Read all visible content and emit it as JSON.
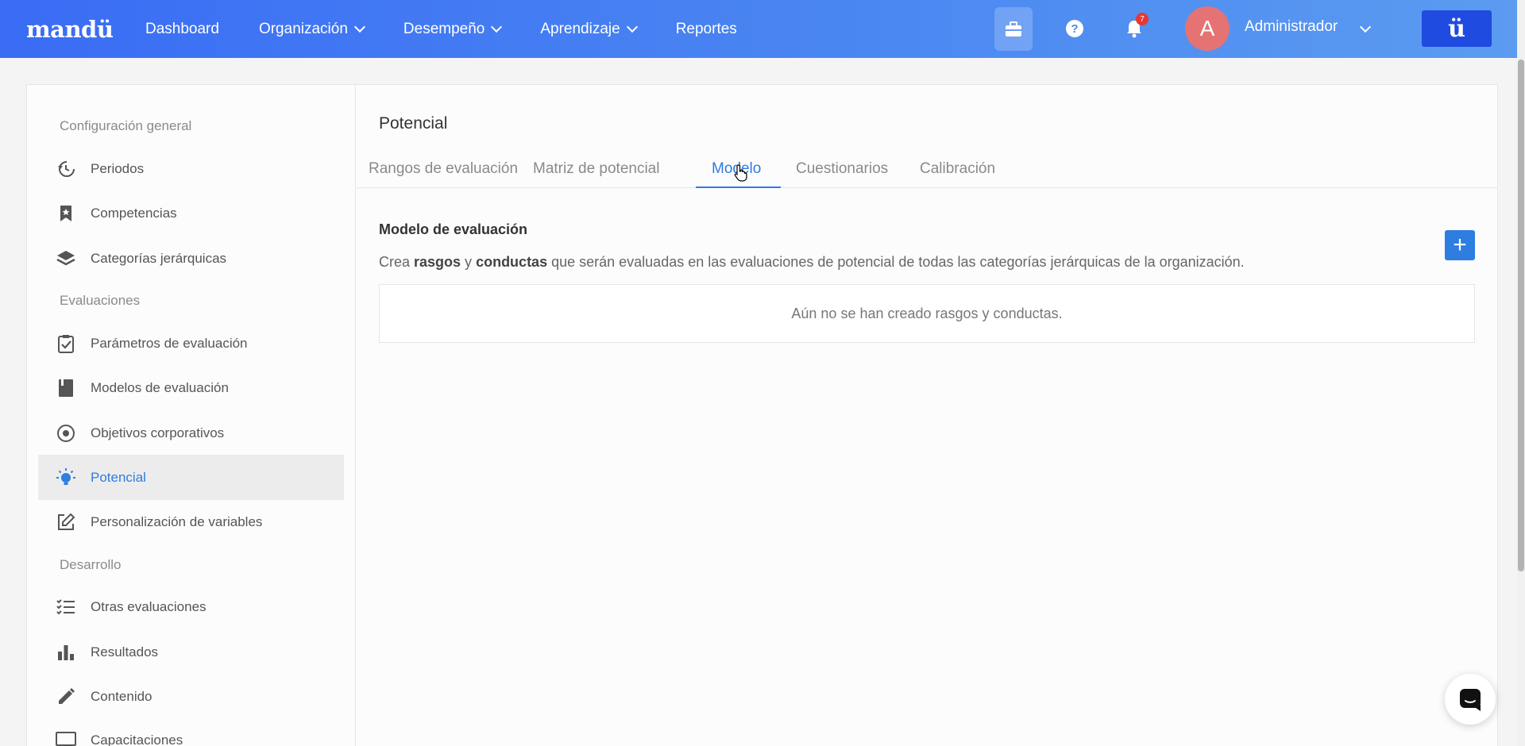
{
  "topnav": {
    "logo": "mandü",
    "items": [
      {
        "label": "Dashboard"
      },
      {
        "label": "Organización"
      },
      {
        "label": "Desempeño"
      },
      {
        "label": "Aprendizaje"
      },
      {
        "label": "Reportes"
      }
    ],
    "notifications_count": "7",
    "avatar_letter": "A",
    "user_name": "Administrador",
    "brand_button": "ü"
  },
  "sidebar": {
    "sections": [
      {
        "title": "Configuración general"
      },
      {
        "title": "Evaluaciones"
      },
      {
        "title": "Desarrollo"
      }
    ],
    "items": [
      {
        "label": "Periodos",
        "icon": "history-icon"
      },
      {
        "label": "Competencias",
        "icon": "bookmark-icon"
      },
      {
        "label": "Categorías jerárquicas",
        "icon": "layers-icon"
      },
      {
        "label": "Parámetros de evaluación",
        "icon": "clipboard-check-icon"
      },
      {
        "label": "Modelos de evaluación",
        "icon": "book-icon"
      },
      {
        "label": "Objetivos corporativos",
        "icon": "target-icon"
      },
      {
        "label": "Potencial",
        "icon": "lightbulb-icon",
        "active": true
      },
      {
        "label": "Personalización de variables",
        "icon": "edit-icon"
      },
      {
        "label": "Otras evaluaciones",
        "icon": "checklist-icon"
      },
      {
        "label": "Resultados",
        "icon": "bar-chart-icon"
      },
      {
        "label": "Contenido",
        "icon": "pencil-icon"
      },
      {
        "label": "Capacitaciones",
        "icon": "monitor-icon"
      }
    ]
  },
  "main": {
    "title": "Potencial",
    "tabs": [
      {
        "label": "Rangos de evaluación"
      },
      {
        "label": "Matriz de potencial"
      },
      {
        "label": "Modelo",
        "active": true
      },
      {
        "label": "Cuestionarios"
      },
      {
        "label": "Calibración"
      }
    ],
    "section_heading": "Modelo de evaluación",
    "desc_prefix": "Crea ",
    "desc_bold1": "rasgos",
    "desc_mid": " y ",
    "desc_bold2": "conductas",
    "desc_suffix": " que serán evaluadas en las evaluaciones de potencial de todas las categorías jerárquicas de la organización.",
    "add_label": "+",
    "empty_text": "Aún no se han creado rasgos y conductas."
  },
  "colors": {
    "accent": "#2e7de0",
    "topbar_start": "#3a6cf4",
    "topbar_end": "#5b9bf0",
    "badge": "#e53935",
    "avatar": "#e57373"
  }
}
